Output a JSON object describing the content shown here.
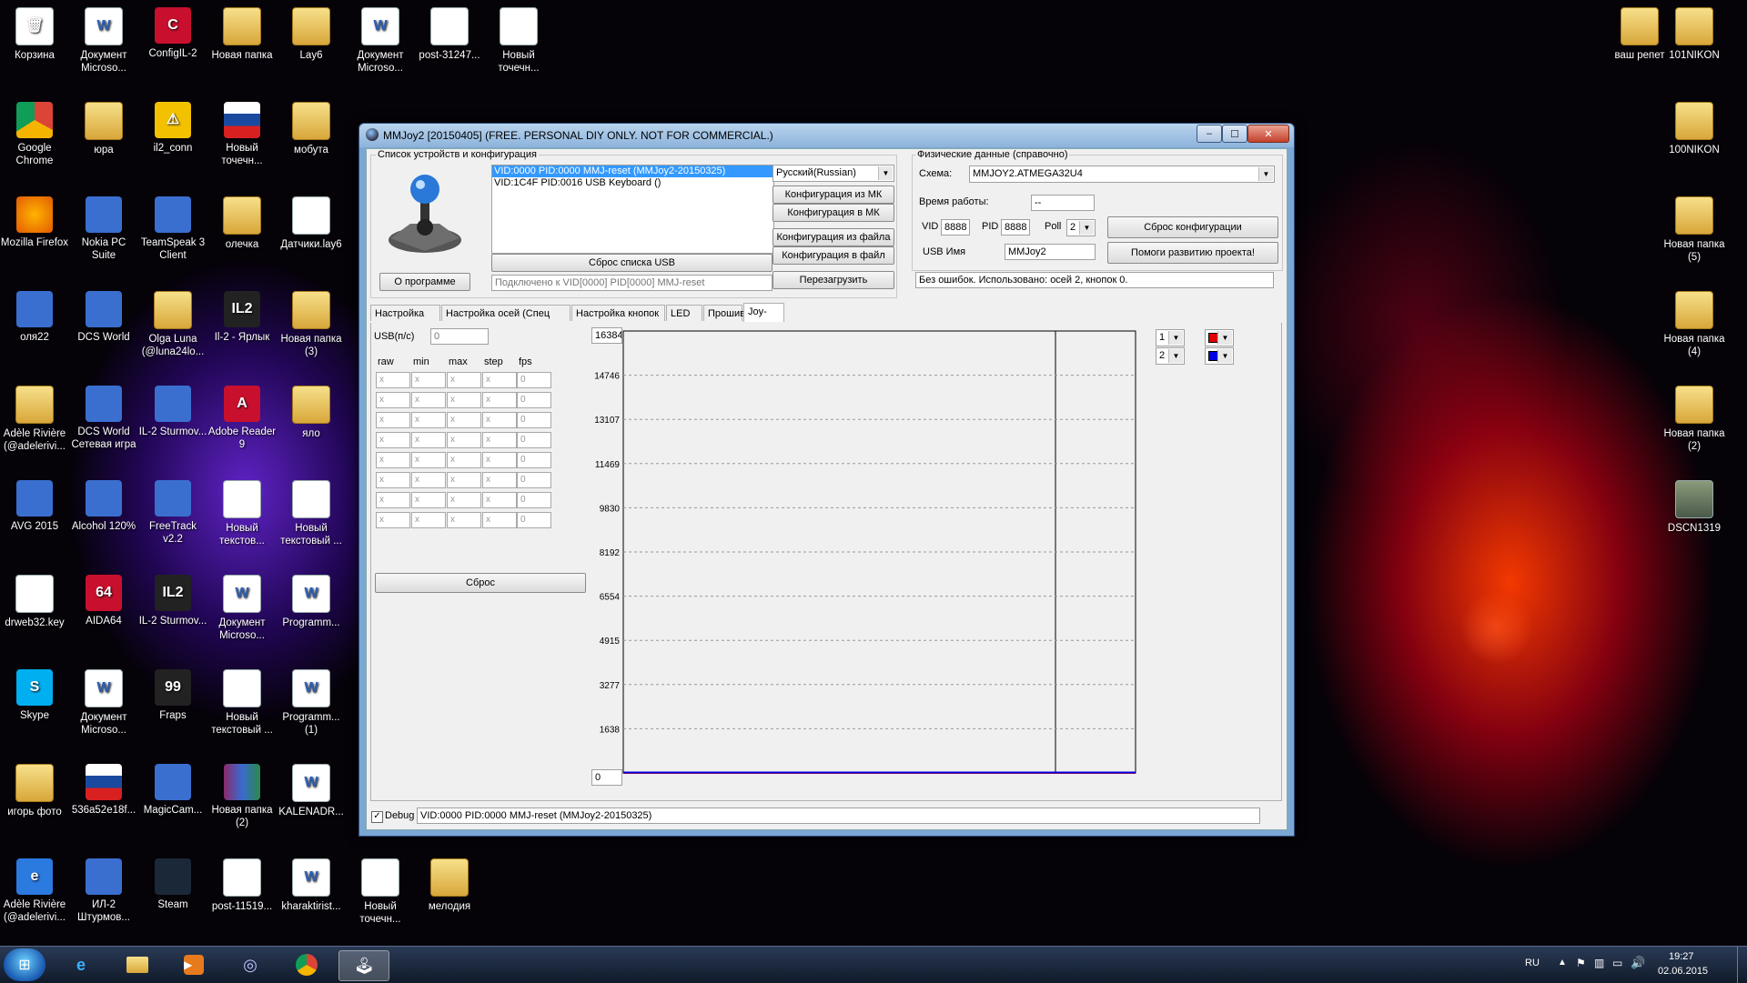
{
  "desktop": {
    "icons_left": [
      {
        "label": "Корзина",
        "kind": "trash"
      },
      {
        "label": "Документ Microso...",
        "kind": "wdoc"
      },
      {
        "label": "ConfigIL-2",
        "kind": "config"
      },
      {
        "label": "Новая папка",
        "kind": "folder"
      },
      {
        "label": "Lay6",
        "kind": "folder"
      },
      {
        "label": "Документ Microso...",
        "kind": "wdoc"
      },
      {
        "label": "post-31247...",
        "kind": "image"
      },
      {
        "label": "Новый точечн...",
        "kind": "image"
      },
      {
        "label": "Google Chrome",
        "kind": "chrome"
      },
      {
        "label": "юра",
        "kind": "folder"
      },
      {
        "label": "il2_conn",
        "kind": "warning"
      },
      {
        "label": "Новый точечн...",
        "kind": "flag"
      },
      {
        "label": "мобута",
        "kind": "folder"
      },
      {
        "label": "Mozilla Firefox",
        "kind": "firefox"
      },
      {
        "label": "Nokia PC Suite",
        "kind": "app"
      },
      {
        "label": "TeamSpeak 3 Client",
        "kind": "app"
      },
      {
        "label": "олечка",
        "kind": "folder"
      },
      {
        "label": "Датчики.lay6",
        "kind": "doc"
      },
      {
        "label": "оля22",
        "kind": "app"
      },
      {
        "label": "DCS World",
        "kind": "app"
      },
      {
        "label": "Olga Luna (@luna24lo...",
        "kind": "folder"
      },
      {
        "label": "Il-2 - Ярлык",
        "kind": "il2"
      },
      {
        "label": "Новая папка (3)",
        "kind": "folder"
      },
      {
        "label": "Adèle Rivière (@adelerivi...",
        "kind": "folder"
      },
      {
        "label": "DCS World Сетевая игра",
        "kind": "app"
      },
      {
        "label": "IL-2 Sturmov...",
        "kind": "app"
      },
      {
        "label": "Adobe Reader 9",
        "kind": "pdf"
      },
      {
        "label": "яло",
        "kind": "folder"
      },
      {
        "label": "AVG 2015",
        "kind": "app"
      },
      {
        "label": "Alcohol 120%",
        "kind": "app"
      },
      {
        "label": "FreeTrack v2.2",
        "kind": "app"
      },
      {
        "label": "Новый текстов...",
        "kind": "doc"
      },
      {
        "label": "Новый текстовый ...",
        "kind": "doc"
      },
      {
        "label": "drweb32.key",
        "kind": "doc"
      },
      {
        "label": "AIDA64",
        "kind": "aida"
      },
      {
        "label": "IL-2 Sturmov...",
        "kind": "il2"
      },
      {
        "label": "Документ Microso...",
        "kind": "wdoc"
      },
      {
        "label": "Programm...",
        "kind": "wdoc"
      },
      {
        "label": "Skype",
        "kind": "skype"
      },
      {
        "label": "Документ Microso...",
        "kind": "wdoc"
      },
      {
        "label": "Fraps",
        "kind": "fraps"
      },
      {
        "label": "Новый текстовый ...",
        "kind": "doc"
      },
      {
        "label": "Programm... (1)",
        "kind": "wdoc"
      },
      {
        "label": "игорь фото",
        "kind": "folder"
      },
      {
        "label": "536a52e18f...",
        "kind": "flag"
      },
      {
        "label": "MagicCam...",
        "kind": "app"
      },
      {
        "label": "Новая папка (2)",
        "kind": "rar"
      },
      {
        "label": "KALENADR...",
        "kind": "wdoc"
      },
      {
        "label": "Adèle Rivière (@adelerivi...",
        "kind": "ie"
      },
      {
        "label": "ИЛ-2 Штурмов...",
        "kind": "app"
      },
      {
        "label": "Steam",
        "kind": "steam"
      },
      {
        "label": "post-11519...",
        "kind": "image"
      },
      {
        "label": "kharaktirist...",
        "kind": "wdoc"
      },
      {
        "label": "Новый точечн...",
        "kind": "image"
      },
      {
        "label": "мелодия",
        "kind": "folder"
      }
    ],
    "icons_right": [
      {
        "label": "ваш репет",
        "kind": "folder"
      },
      {
        "label": "101NIKON",
        "kind": "folder"
      },
      {
        "label": "100NIKON",
        "kind": "folder"
      },
      {
        "label": "Новая папка (5)",
        "kind": "folder"
      },
      {
        "label": "Новая папка (4)",
        "kind": "folder"
      },
      {
        "label": "Новая папка (2)",
        "kind": "folder"
      },
      {
        "label": "DSCN1319",
        "kind": "photo"
      }
    ]
  },
  "window": {
    "title": "MMJoy2 [20150405] (FREE. PERSONAL DIY ONLY. NOT FOR COMMERCIAL.)",
    "controls": {
      "minimize": "–",
      "maximize": "☐",
      "close": "✕"
    },
    "devices_group": {
      "label": "Список устройств и конфигурация",
      "devices": [
        "VID:0000 PID:0000 MMJ-reset (MMJoy2-20150325)",
        "VID:1C4F PID:0016 USB Keyboard ()"
      ],
      "reset_usb_list": "Сброс списка USB",
      "about": "О программе",
      "connection_status": "Подключено к VID[0000] PID[0000] MMJ-reset",
      "language": "Русский(Russian)",
      "config_from_mk": "Конфигурация из МК",
      "config_to_mk": "Конфигурация в МК",
      "config_from_file": "Конфигурация из файла",
      "config_to_file": "Конфигурация в файл",
      "reboot": "Перезагрузить"
    },
    "physical_group": {
      "label": "Физические данные (справочно)",
      "scheme_label": "Схема:",
      "scheme_value": "MMJOY2.ATMEGA32U4",
      "uptime_label": "Время работы:",
      "uptime_value": "--",
      "vid_label": "VID",
      "vid_value": "8888",
      "pid_label": "PID",
      "pid_value": "8888",
      "poll_label": "Poll",
      "poll_value": "2",
      "usb_name_label": "USB Имя",
      "usb_name_value": "MMJoy2",
      "reset_config": "Сброс конфигурации",
      "help_project": "Помоги развитию проекта!",
      "status": "Без ошибок. Использовано: осей  2, кнопок  0."
    },
    "tabs": [
      {
        "label": "Настройка осей",
        "active": false
      },
      {
        "label": "Настройка осей (Спец функции)",
        "active": false
      },
      {
        "label": "Настройка кнопок",
        "active": false
      },
      {
        "label": "LED",
        "active": false
      },
      {
        "label": "Прошивка",
        "active": false
      },
      {
        "label": "Joy-tester",
        "active": true
      }
    ],
    "joytester": {
      "usb_rate_label": "USB(п/с)",
      "usb_rate_value": "0",
      "columns": [
        "raw",
        "min",
        "max",
        "step",
        "fps"
      ],
      "rows": [
        [
          "x",
          "x",
          "x",
          "x",
          "0"
        ],
        [
          "x",
          "x",
          "x",
          "x",
          "0"
        ],
        [
          "x",
          "x",
          "x",
          "x",
          "0"
        ],
        [
          "x",
          "x",
          "x",
          "x",
          "0"
        ],
        [
          "x",
          "x",
          "x",
          "x",
          "0"
        ],
        [
          "x",
          "x",
          "x",
          "x",
          "0"
        ],
        [
          "x",
          "x",
          "x",
          "x",
          "0"
        ],
        [
          "x",
          "x",
          "x",
          "x",
          "0"
        ]
      ],
      "reset": "Сброс",
      "scale_max": "16384",
      "scale_min": "0",
      "channels": [
        {
          "index": "1",
          "color": "#e00000"
        },
        {
          "index": "2",
          "color": "#0000e0"
        }
      ]
    },
    "chart_data": {
      "type": "line",
      "title": "",
      "xlabel": "",
      "ylabel": "",
      "ylim": [
        0,
        16384
      ],
      "y_ticks": [
        1638,
        3277,
        4915,
        6554,
        8192,
        9830,
        11469,
        13107,
        14746
      ],
      "grid": true,
      "series": [
        {
          "values": [
            0,
            0,
            0,
            0,
            0,
            0,
            0,
            0,
            0,
            0
          ],
          "color": "#e00000"
        },
        {
          "values": [
            0,
            0,
            0,
            0,
            0,
            0,
            0,
            0,
            0,
            0
          ],
          "color": "#0000e0"
        }
      ]
    },
    "debug": {
      "label": "Debug",
      "checked": true,
      "value": "VID:0000 PID:0000 MMJ-reset (MMJoy2-20150325)"
    }
  },
  "taskbar": {
    "language": "RU",
    "time": "19:27",
    "date": "02.06.2015"
  },
  "colors": {
    "selection": "#3399ff",
    "titlebar": "#a8c8ea",
    "client": "#f0f0f0"
  }
}
